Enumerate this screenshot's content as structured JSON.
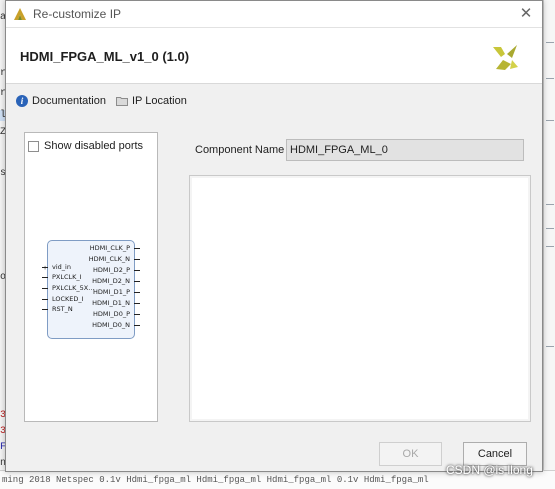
{
  "background": {
    "left_fragments": [
      "a",
      "r",
      "ro",
      "l_",
      "Z",
      "s",
      "o",
      "3",
      "3",
      "F",
      "n"
    ],
    "bottom_text": "ming 2018   Netspec   0.1v Hdmi_fpga_ml   Hdmi_fpga_ml   Hdmi_fpga_ml   0.1v   Hdmi_fpga_ml"
  },
  "dialog": {
    "title": "Re-customize IP",
    "ip_name": "HDMI_FPGA_ML_v1_0 (1.0)",
    "links": {
      "documentation": "Documentation",
      "ip_location": "IP Location"
    },
    "show_disabled_ports": {
      "label": "Show disabled ports",
      "checked": false
    },
    "symbol": {
      "inputs": [
        "vid_in",
        "PXLCLK_I",
        "PXLCLK_5X...",
        "LOCKED_I",
        "RST_N"
      ],
      "outputs": [
        "HDMI_CLK_P",
        "HDMI_CLK_N",
        "HDMI_D2_P",
        "HDMI_D2_N",
        "HDMI_D1_P",
        "HDMI_D1_N",
        "HDMI_D0_P",
        "HDMI_D0_N"
      ]
    },
    "component_name_label": "Component Name",
    "component_name_value": "HDMI_FPGA_ML_0",
    "buttons": {
      "ok": "OK",
      "cancel": "Cancel"
    }
  },
  "watermark": "CSDN @is llong",
  "colors": {
    "accent_blue": "#2a63b8",
    "xilinx_yellow": "#c8c63a",
    "symbol_border": "#7f9cc4"
  }
}
